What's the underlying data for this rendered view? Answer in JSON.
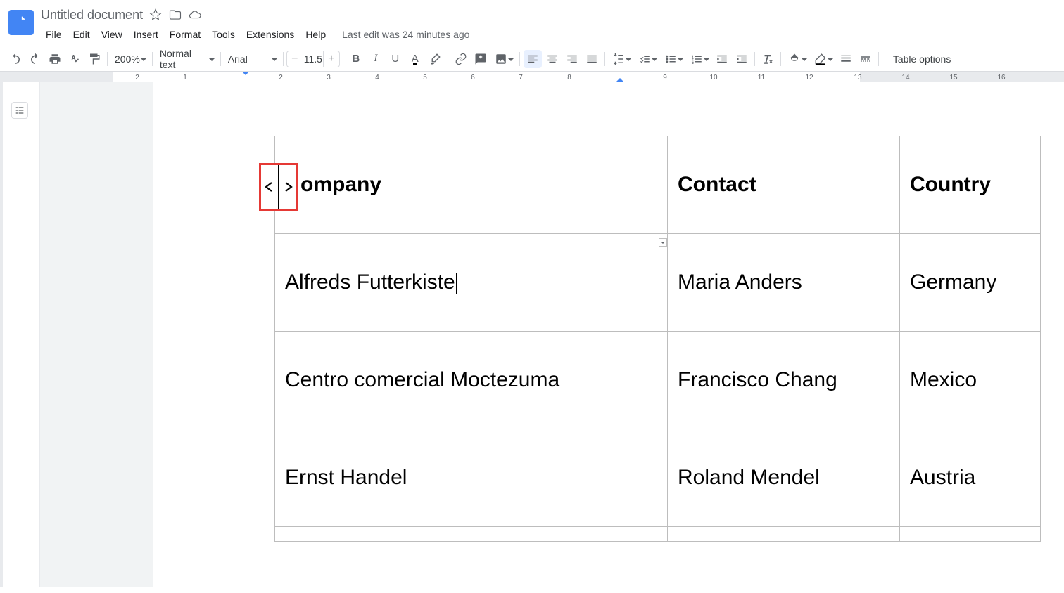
{
  "app": {
    "title": "Untitled document"
  },
  "menus": {
    "file": "File",
    "edit": "Edit",
    "view": "View",
    "insert": "Insert",
    "format": "Format",
    "tools": "Tools",
    "extensions": "Extensions",
    "help": "Help"
  },
  "lastedit": "Last edit was 24 minutes ago",
  "toolbar": {
    "zoom": "200%",
    "style": "Normal text",
    "font": "Arial",
    "font_size": "11.5",
    "table_options": "Table options"
  },
  "ruler": {
    "labels": [
      "2",
      "1",
      "2",
      "3",
      "4",
      "5",
      "6",
      "7",
      "8",
      "9",
      "10",
      "11",
      "12",
      "13",
      "14",
      "15",
      "16"
    ]
  },
  "table": {
    "headers": {
      "company": "Company",
      "contact": "Contact",
      "country": "Country"
    },
    "header_visible_company": "ompany",
    "rows": [
      {
        "company": "Alfreds Futterkiste",
        "contact": "Maria Anders",
        "country": "Germany"
      },
      {
        "company": "Centro comercial Moctezuma",
        "contact": "Francisco Chang",
        "country": "Mexico"
      },
      {
        "company": "Ernst Handel",
        "contact": "Roland Mendel",
        "country": "Austria"
      }
    ]
  }
}
